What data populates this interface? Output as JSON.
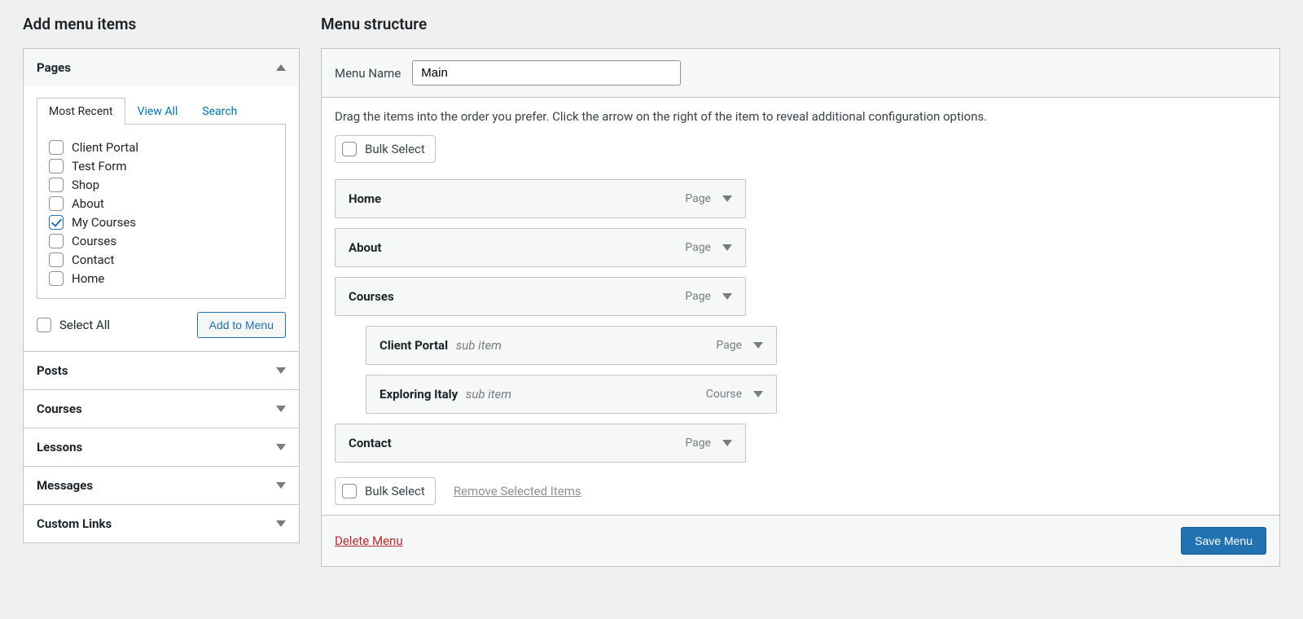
{
  "left": {
    "title": "Add menu items",
    "sections": [
      {
        "label": "Pages",
        "open": true
      },
      {
        "label": "Posts",
        "open": false
      },
      {
        "label": "Courses",
        "open": false
      },
      {
        "label": "Lessons",
        "open": false
      },
      {
        "label": "Messages",
        "open": false
      },
      {
        "label": "Custom Links",
        "open": false
      }
    ],
    "tabs": {
      "recent": "Most Recent",
      "all": "View All",
      "search": "Search"
    },
    "pages": [
      {
        "label": "Client Portal",
        "checked": false
      },
      {
        "label": "Test Form",
        "checked": false
      },
      {
        "label": "Shop",
        "checked": false
      },
      {
        "label": "About",
        "checked": false
      },
      {
        "label": "My Courses",
        "checked": true
      },
      {
        "label": "Courses",
        "checked": false
      },
      {
        "label": "Contact",
        "checked": false
      },
      {
        "label": "Home",
        "checked": false
      }
    ],
    "select_all": "Select All",
    "add_to_menu": "Add to Menu"
  },
  "right": {
    "title": "Menu structure",
    "menu_name_label": "Menu Name",
    "menu_name_value": "Main",
    "instructions": "Drag the items into the order you prefer. Click the arrow on the right of the item to reveal additional configuration options.",
    "bulk_select": "Bulk Select",
    "remove_selected": "Remove Selected Items",
    "sub_item_text": "sub item",
    "items": [
      {
        "title": "Home",
        "type": "Page",
        "depth": 0
      },
      {
        "title": "About",
        "type": "Page",
        "depth": 0
      },
      {
        "title": "Courses",
        "type": "Page",
        "depth": 0
      },
      {
        "title": "Client Portal",
        "type": "Page",
        "depth": 1
      },
      {
        "title": "Exploring Italy",
        "type": "Course",
        "depth": 1
      },
      {
        "title": "Contact",
        "type": "Page",
        "depth": 0
      }
    ],
    "delete_menu": "Delete Menu",
    "save_menu": "Save Menu"
  }
}
